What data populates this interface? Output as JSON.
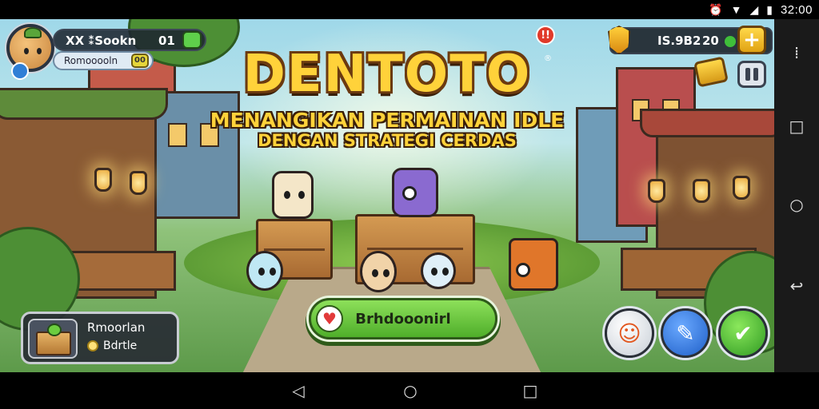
{
  "status_bar": {
    "time": "32:00",
    "icons": [
      "alarm-icon",
      "wifi-icon",
      "signal-icon",
      "battery-icon"
    ]
  },
  "game": {
    "title": "DENTOTO",
    "trademark": "®",
    "subtitle_line1": "MENANGIKAN PERMAINAN IDLE",
    "subtitle_line2": "DENGAN STRATEGI CERDAS",
    "notification_badge": "!!"
  },
  "profile": {
    "name": "XX ⁑Sookn",
    "level": "01",
    "sub_label": "Romooooln"
  },
  "currency": {
    "value": "IS.9B2",
    "count": "20",
    "plus_label": "+"
  },
  "bottom_panel": {
    "title": "Rmoorlan",
    "value": "Bdrtle"
  },
  "main_button": {
    "label": "Brhdooonirl"
  },
  "nav_right": [
    "menu-dots-icon",
    "square-icon",
    "circle-icon",
    "back-icon"
  ],
  "nav_bottom": [
    "back-triangle-icon",
    "home-circle-icon",
    "recents-square-icon"
  ],
  "colors": {
    "title_gold": "#ffd23a",
    "button_green": "#4fae2a",
    "accent_blue": "#1f5fc8"
  }
}
